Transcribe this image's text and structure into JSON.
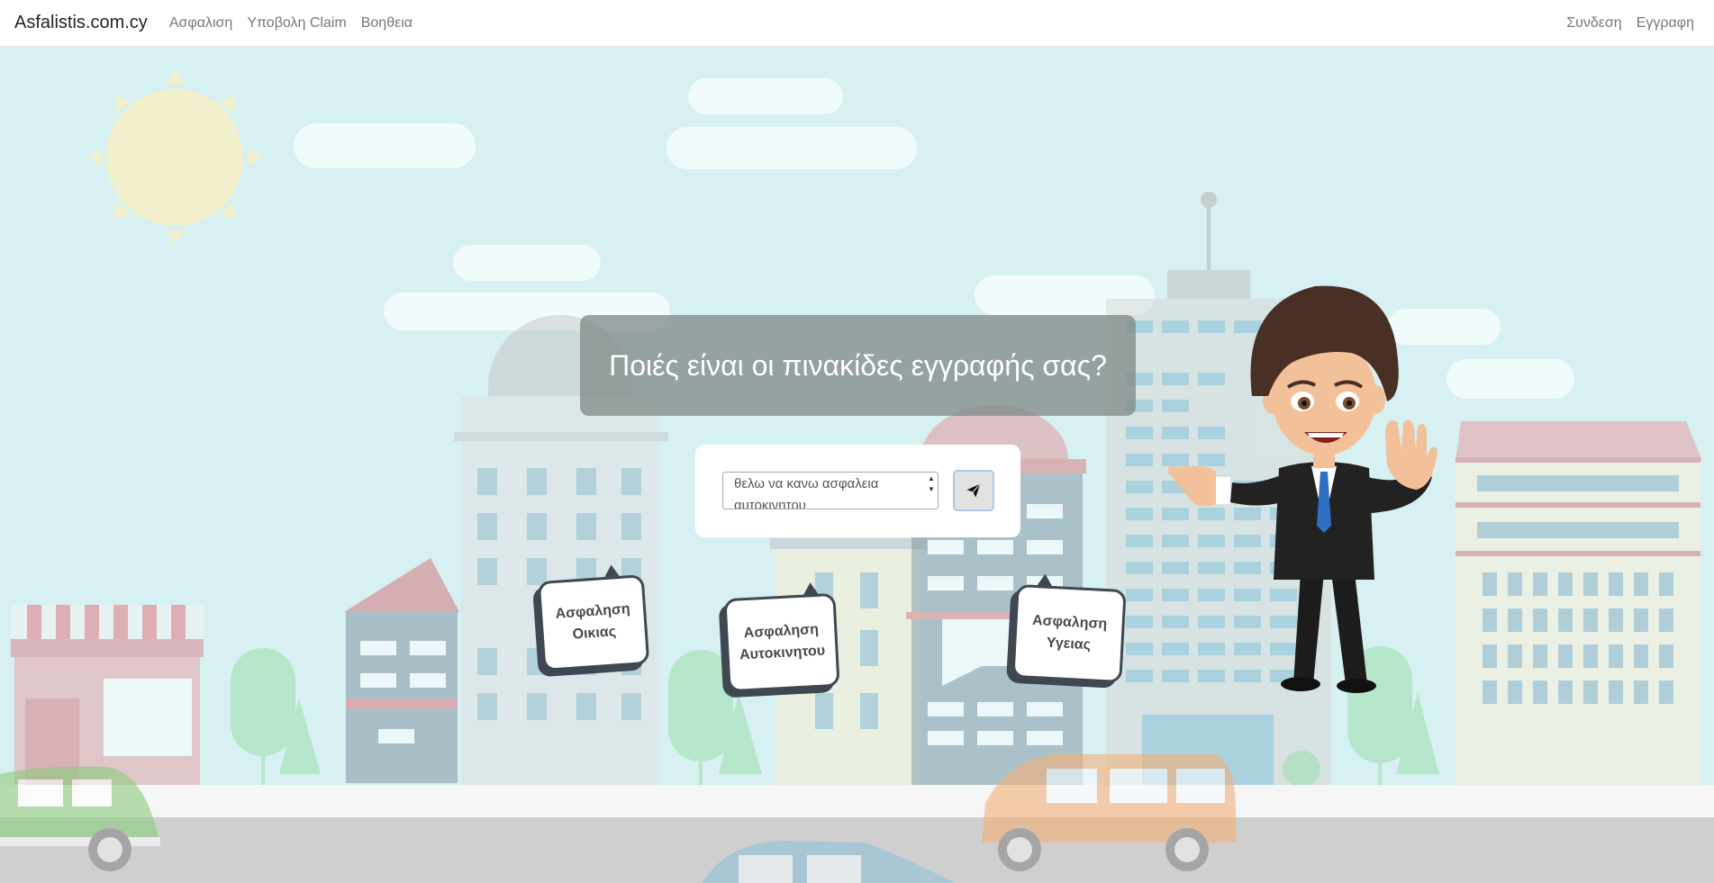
{
  "navbar": {
    "brand": "Asfalistis.com.cy",
    "links": [
      "Ασφαλιση",
      "Υποβολη Claim",
      "Βοηθεια"
    ],
    "right_links": [
      "Συνδεση",
      "Εγγραφη"
    ]
  },
  "hero": {
    "question": "Ποιές είναι οι πινακίδες εγγραφής σας?",
    "answer_value": "θελω να κανω ασφαλεια αυτοκινητου",
    "send_icon": "paper-plane-icon"
  },
  "bubbles": [
    {
      "label": "Ασφαληση Οικιας"
    },
    {
      "label": "Ασφαληση Αυτοκινητου"
    },
    {
      "label": "Ασφαληση Υγειας"
    }
  ],
  "colors": {
    "sky": "#d7f0f1",
    "bubble_border": "#3f4852",
    "send_button_border": "#a9c9ec"
  }
}
